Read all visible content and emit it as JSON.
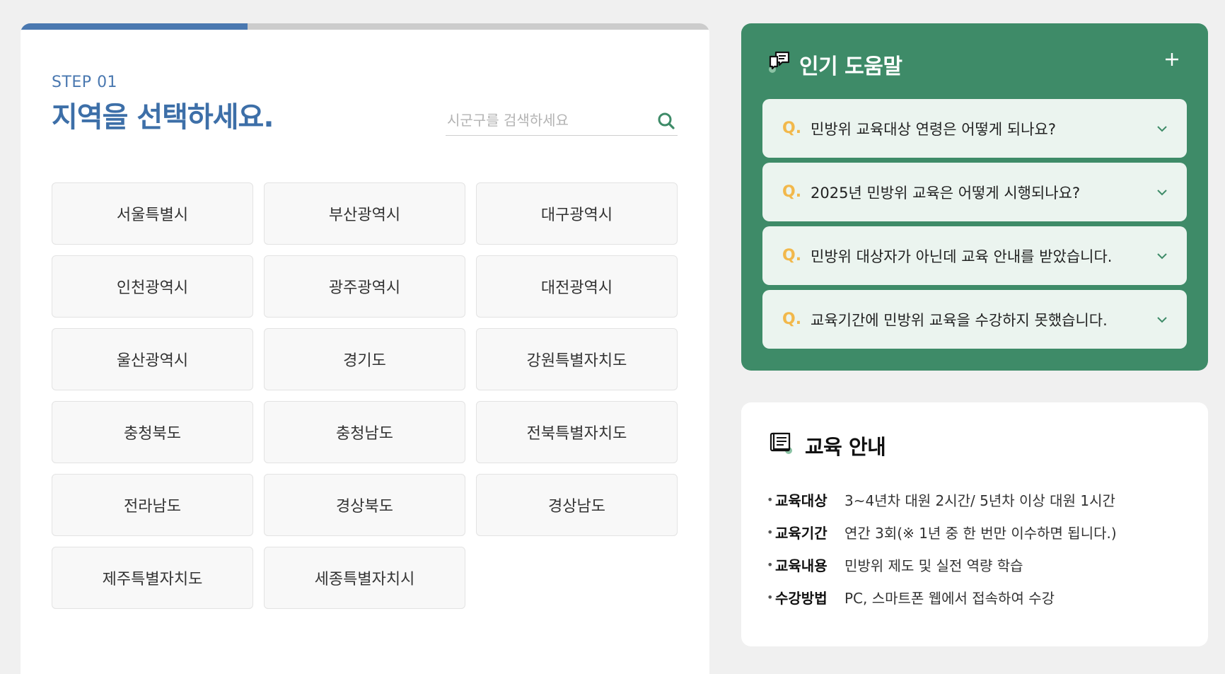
{
  "step": {
    "label": "STEP 01",
    "title": "지역을 선택하세요.",
    "progress_fraction": 0.33
  },
  "search": {
    "placeholder": "시군구를 검색하세요",
    "value": ""
  },
  "regions": [
    "서울특별시",
    "부산광역시",
    "대구광역시",
    "인천광역시",
    "광주광역시",
    "대전광역시",
    "울산광역시",
    "경기도",
    "강원특별자치도",
    "충청북도",
    "충청남도",
    "전북특별자치도",
    "전라남도",
    "경상북도",
    "경상남도",
    "제주특별자치도",
    "세종특별자치시"
  ],
  "faq": {
    "title": "인기 도움말",
    "q_marker": "Q.",
    "items": [
      "민방위 교육대상 연령은 어떻게 되나요?",
      "2025년 민방위 교육은 어떻게 시행되나요?",
      "민방위 대상자가 아닌데 교육 안내를 받았습니다.",
      "교육기간에 민방위 교육을 수강하지 못했습니다."
    ]
  },
  "info": {
    "title": "교육 안내",
    "rows": [
      {
        "label": "교육대상",
        "value": "3~4년차 대원 2시간/ 5년차 이상 대원 1시간"
      },
      {
        "label": "교육기간",
        "value": "연간 3회(※ 1년 중 한 번만 이수하면 됩니다.)"
      },
      {
        "label": "교육내용",
        "value": "민방위 제도 및 실전 역량 학습"
      },
      {
        "label": "수강방법",
        "value": "PC, 스마트폰 웹에서 접속하여 수강"
      }
    ]
  },
  "colors": {
    "accent_blue": "#4a78b0",
    "faq_green": "#3e8b68",
    "q_yellow": "#f2b84b"
  }
}
